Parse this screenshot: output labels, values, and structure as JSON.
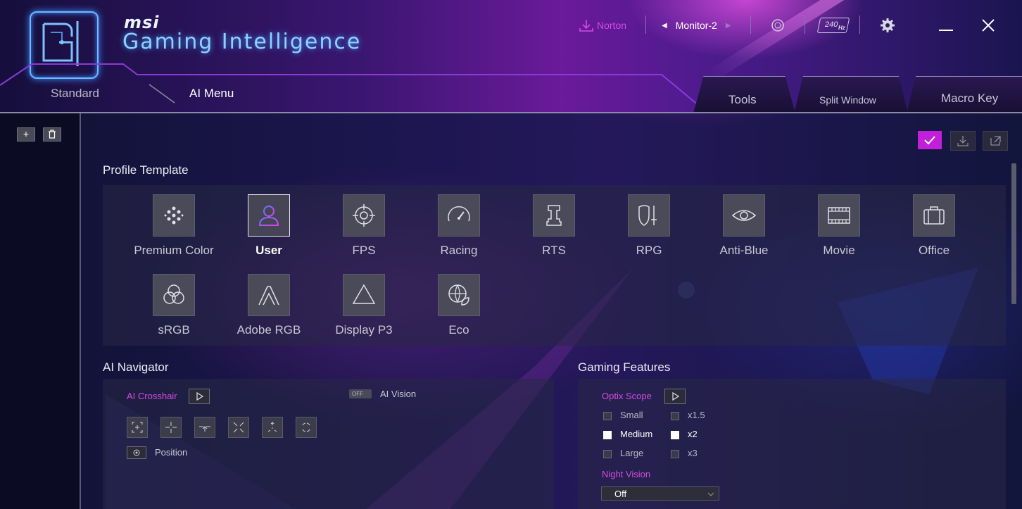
{
  "app": {
    "brand": "msi",
    "title": "Gaming Intelligence"
  },
  "topbar": {
    "norton": "Norton",
    "monitor": "Monitor-2",
    "refresh_badge": "240",
    "refresh_unit": "Hz",
    "icons": [
      "download-icon",
      "rgb-icon",
      "refresh-rate-icon",
      "gear-icon",
      "minimize-icon",
      "close-icon"
    ]
  },
  "tabs": {
    "standard": "Standard",
    "ai_menu": "AI Menu",
    "tools": "Tools",
    "split_window": "Split Window",
    "macro_key": "Macro Key"
  },
  "colors": {
    "accent": "#d34ce0",
    "apply": "#c21fd8"
  },
  "profile": {
    "title": "Profile Template",
    "selected": "User",
    "tiles": [
      {
        "label": "Premium Color",
        "icon": "premium-color-icon"
      },
      {
        "label": "User",
        "icon": "user-icon"
      },
      {
        "label": "FPS",
        "icon": "crosshair-icon"
      },
      {
        "label": "Racing",
        "icon": "speedometer-icon"
      },
      {
        "label": "RTS",
        "icon": "chess-rook-icon"
      },
      {
        "label": "RPG",
        "icon": "shield-sword-icon"
      },
      {
        "label": "Anti-Blue",
        "icon": "eye-icon"
      },
      {
        "label": "Movie",
        "icon": "film-icon"
      },
      {
        "label": "Office",
        "icon": "briefcase-icon"
      },
      {
        "label": "sRGB",
        "icon": "rgb-circles-icon"
      },
      {
        "label": "Adobe RGB",
        "icon": "adobe-icon"
      },
      {
        "label": "Display P3",
        "icon": "triangle-icon"
      },
      {
        "label": "Eco",
        "icon": "globe-leaf-icon"
      }
    ]
  },
  "ai_navigator": {
    "title": "AI Navigator",
    "crosshair_label": "AI Crosshair",
    "vision_toggle": "OFF",
    "vision_label": "AI Vision",
    "position_label": "Position"
  },
  "gaming": {
    "title": "Gaming Features",
    "optix_label": "Optix Scope",
    "sizes": [
      {
        "label": "Small",
        "checked": false
      },
      {
        "label": "Medium",
        "checked": true
      },
      {
        "label": "Large",
        "checked": false
      }
    ],
    "zooms": [
      {
        "label": "x1.5",
        "checked": false
      },
      {
        "label": "x2",
        "checked": true
      },
      {
        "label": "x3",
        "checked": false
      }
    ],
    "night_label": "Night Vision",
    "night_value": "Off"
  }
}
